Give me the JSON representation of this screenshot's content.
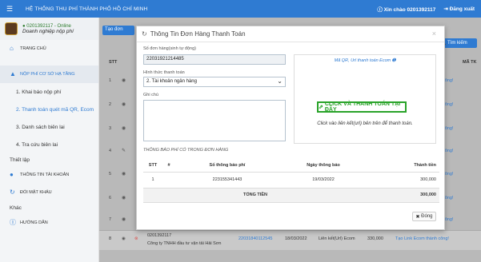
{
  "app": {
    "title": "HỆ THỐNG THU PHÍ THÀNH PHỐ HỒ CHÍ MINH",
    "greeting": "Xin chào 0201392117",
    "logout": "Đăng xuất"
  },
  "user": {
    "id_status": "0201392117 - Online",
    "role": "Doanh nghiệp nộp phí"
  },
  "sidebar": {
    "home": "TRANG CHỦ",
    "group": "NỘP PHÍ CƠ SỞ HẠ TẦNG",
    "subs": [
      "1. Khai báo nộp phí",
      "2. Thanh toán quét mã QR, Ecom",
      "3. Danh sách biên lai",
      "4. Tra cứu biên lai"
    ],
    "settings": "Thiết lập",
    "account": "THÔNG TIN TÀI KHOẢN",
    "password": "ĐỔI MẬT KHẨU",
    "other": "Khác",
    "guide": "HƯỚNG DẪN"
  },
  "background": {
    "add_button": "Tạo đơn",
    "search_button": "Tìm kiếm",
    "stt_header": "STT",
    "code_header": "MÃ TK",
    "rows": [
      "1",
      "2",
      "3",
      "4",
      "5",
      "6",
      "7",
      "8"
    ],
    "link_text": "công!",
    "last_row": {
      "stt": "8",
      "id": "0201392117",
      "company": "Công ty TNHH đầu tư vận tải Hải Sơn",
      "code": "22031840112545",
      "date": "18/03/2022",
      "method": "Liên kết(Url) Ecom",
      "amount": "330,000",
      "status": "Tạo Link Ecom thành công!"
    }
  },
  "modal": {
    "title": "Thông Tin Đơn Hàng Thanh Toán",
    "order_label": "Số đơn hàng(sinh tự động)",
    "order_value": "22031921214485",
    "method_label": "Hình thức thanh toán",
    "method_value": "2. Tài khoản ngân hàng",
    "note_label": "Ghi chú",
    "qr_link": "Mã QR, Url thanh toán Ecom",
    "pay_button": "CLICK VÀ THANH TOÁN TẠI ĐÂY",
    "pay_note": "Click vào liên kết(url) bên trên để thanh toán.",
    "fee_title": "THÔNG BÁO PHÍ CÓ TRONG ĐƠN HÀNG",
    "headers": [
      "STT",
      "#",
      "Số thông báo phí",
      "Ngày thông báo",
      "Thành tiền"
    ],
    "items": [
      {
        "stt": "1",
        "num": "223155341443",
        "date": "19/03/2022",
        "amount": "300,000"
      }
    ],
    "total_label": "TỔNG TIỀN",
    "total_value": "300,000",
    "close": "Đóng"
  },
  "colors": {
    "primary": "#2f7bd2",
    "success": "#29a329"
  }
}
